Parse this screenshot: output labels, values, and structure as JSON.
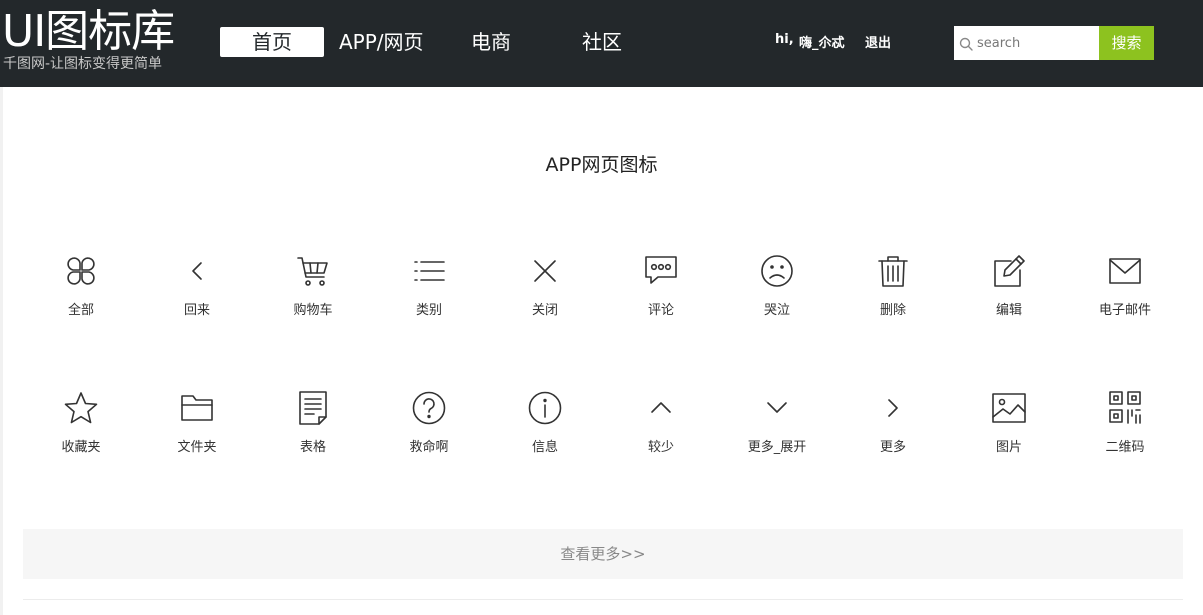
{
  "logo": {
    "title": "UI图标库",
    "subtitle": "千图网-让图标变得更简单"
  },
  "nav": [
    {
      "label": "首页"
    },
    {
      "label": "APP/网页"
    },
    {
      "label": "电商"
    },
    {
      "label": "社区"
    }
  ],
  "user": {
    "greeting": "hi,",
    "name": "嗨_尒忒",
    "logout": "退出"
  },
  "search": {
    "placeholder": "search",
    "button": "搜索"
  },
  "section_title": "APP网页图标",
  "icons_row1": [
    {
      "label": "全部",
      "icon": "clover-icon"
    },
    {
      "label": "回来",
      "icon": "chevron-left-icon"
    },
    {
      "label": "购物车",
      "icon": "cart-icon"
    },
    {
      "label": "类别",
      "icon": "list-icon"
    },
    {
      "label": "关闭",
      "icon": "close-icon"
    },
    {
      "label": "评论",
      "icon": "comment-icon"
    },
    {
      "label": "哭泣",
      "icon": "sad-face-icon"
    },
    {
      "label": "删除",
      "icon": "trash-icon"
    },
    {
      "label": "编辑",
      "icon": "edit-icon"
    },
    {
      "label": "电子邮件",
      "icon": "mail-icon"
    }
  ],
  "icons_row2": [
    {
      "label": "收藏夹",
      "icon": "star-icon"
    },
    {
      "label": "文件夹",
      "icon": "folder-icon"
    },
    {
      "label": "表格",
      "icon": "document-icon"
    },
    {
      "label": "救命啊",
      "icon": "help-icon"
    },
    {
      "label": "信息",
      "icon": "info-icon"
    },
    {
      "label": "较少",
      "icon": "chevron-up-icon"
    },
    {
      "label": "更多_展开",
      "icon": "chevron-down-icon"
    },
    {
      "label": "更多",
      "icon": "chevron-right-icon"
    },
    {
      "label": "图片",
      "icon": "image-icon"
    },
    {
      "label": "二维码",
      "icon": "qr-code-icon"
    }
  ],
  "more_link": "查看更多>>"
}
